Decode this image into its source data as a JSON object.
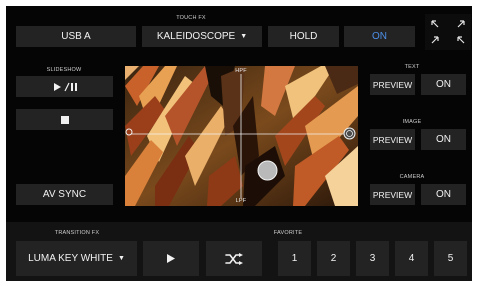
{
  "header": {
    "touch_fx_label": "TOUCH FX"
  },
  "top_bar": {
    "source": "USB A",
    "touch_fx": {
      "selected": "KALEIDOSCOPE",
      "hold": "HOLD",
      "on": "ON"
    }
  },
  "slideshow": {
    "label": "SLIDESHOW",
    "av_sync": "AV SYNC"
  },
  "preview": {
    "top_label": "HPF",
    "bottom_label": "LPF"
  },
  "right": {
    "text": {
      "label": "TEXT",
      "preview": "PREVIEW",
      "on": "ON"
    },
    "image": {
      "label": "IMAGE",
      "preview": "PREVIEW",
      "on": "ON"
    },
    "camera": {
      "label": "CAMERA",
      "preview": "PREVIEW",
      "on": "ON"
    }
  },
  "transition": {
    "label": "TRANSITION FX",
    "selected": "LUMA KEY WHITE"
  },
  "favorite": {
    "label": "FAVORITE",
    "slots": [
      "1",
      "2",
      "3",
      "4",
      "5"
    ]
  },
  "colors": {
    "accent": "#4d8fe8",
    "button": "#232323",
    "background": "#050505"
  },
  "icons": [
    "play-pause-icon",
    "stop-icon",
    "play-icon",
    "shuffle-icon",
    "expand-icon",
    "shrink-icon",
    "dropdown-caret-icon"
  ]
}
